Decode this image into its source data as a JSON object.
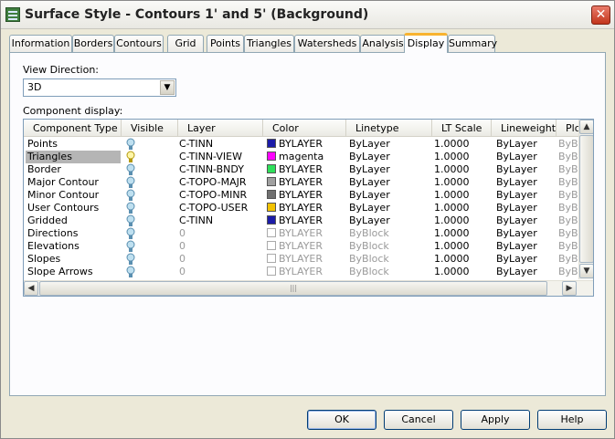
{
  "window": {
    "title": "Surface Style - Contours 1' and 5' (Background)",
    "close_label": "✕"
  },
  "tabs": [
    {
      "label": "Information",
      "active": false
    },
    {
      "label": "Borders",
      "active": false
    },
    {
      "label": "Contours",
      "active": false
    },
    {
      "label": "Grid",
      "active": false
    },
    {
      "label": "Points",
      "active": false
    },
    {
      "label": "Triangles",
      "active": false
    },
    {
      "label": "Watersheds",
      "active": false
    },
    {
      "label": "Analysis",
      "active": false
    },
    {
      "label": "Display",
      "active": true
    },
    {
      "label": "Summary",
      "active": false
    }
  ],
  "view_direction": {
    "label": "View Direction:",
    "value": "3D"
  },
  "component_display": {
    "label": "Component display:",
    "columns": [
      "Component Type",
      "Visible",
      "Layer",
      "Color",
      "Linetype",
      "LT Scale",
      "Lineweight",
      "Plo"
    ],
    "rows": [
      {
        "type": "Points",
        "visible": true,
        "lit": false,
        "layer": "C-TINN",
        "color": "BYLAYER",
        "swatch": "#1c1ca8",
        "linetype": "ByLayer",
        "lt_scale": "1.0000",
        "lineweight": "ByLayer",
        "plot": "ByBl",
        "dim": false,
        "selected": false
      },
      {
        "type": "Triangles",
        "visible": true,
        "lit": true,
        "layer": "C-TINN-VIEW",
        "color": "magenta",
        "swatch": "#ff00ff",
        "linetype": "ByLayer",
        "lt_scale": "1.0000",
        "lineweight": "ByLayer",
        "plot": "ByBl",
        "dim": false,
        "selected": true
      },
      {
        "type": "Border",
        "visible": true,
        "lit": false,
        "layer": "C-TINN-BNDY",
        "color": "BYLAYER",
        "swatch": "#2ee05a",
        "linetype": "ByLayer",
        "lt_scale": "1.0000",
        "lineweight": "ByLayer",
        "plot": "ByBl",
        "dim": false,
        "selected": false
      },
      {
        "type": "Major Contour",
        "visible": true,
        "lit": false,
        "layer": "C-TOPO-MAJR",
        "color": "BYLAYER",
        "swatch": "#a0a0a0",
        "linetype": "ByLayer",
        "lt_scale": "1.0000",
        "lineweight": "ByLayer",
        "plot": "ByBl",
        "dim": false,
        "selected": false
      },
      {
        "type": "Minor Contour",
        "visible": true,
        "lit": false,
        "layer": "C-TOPO-MINR",
        "color": "BYLAYER",
        "swatch": "#707070",
        "linetype": "ByLayer",
        "lt_scale": "1.0000",
        "lineweight": "ByLayer",
        "plot": "ByBl",
        "dim": false,
        "selected": false
      },
      {
        "type": "User Contours",
        "visible": true,
        "lit": false,
        "layer": "C-TOPO-USER",
        "color": "BYLAYER",
        "swatch": "#f2c200",
        "linetype": "ByLayer",
        "lt_scale": "1.0000",
        "lineweight": "ByLayer",
        "plot": "ByBl",
        "dim": false,
        "selected": false
      },
      {
        "type": "Gridded",
        "visible": true,
        "lit": false,
        "layer": "C-TINN",
        "color": "BYLAYER",
        "swatch": "#1c1ca8",
        "linetype": "ByLayer",
        "lt_scale": "1.0000",
        "lineweight": "ByLayer",
        "plot": "ByBl",
        "dim": false,
        "selected": false
      },
      {
        "type": "Directions",
        "visible": true,
        "lit": false,
        "layer": "0",
        "color": "BYLAYER",
        "swatch": "",
        "linetype": "ByBlock",
        "lt_scale": "1.0000",
        "lineweight": "ByLayer",
        "plot": "ByBl",
        "dim": true,
        "selected": false
      },
      {
        "type": "Elevations",
        "visible": true,
        "lit": false,
        "layer": "0",
        "color": "BYLAYER",
        "swatch": "",
        "linetype": "ByBlock",
        "lt_scale": "1.0000",
        "lineweight": "ByLayer",
        "plot": "ByBl",
        "dim": true,
        "selected": false
      },
      {
        "type": "Slopes",
        "visible": true,
        "lit": false,
        "layer": "0",
        "color": "BYLAYER",
        "swatch": "",
        "linetype": "ByBlock",
        "lt_scale": "1.0000",
        "lineweight": "ByLayer",
        "plot": "ByBl",
        "dim": true,
        "selected": false
      },
      {
        "type": "Slope Arrows",
        "visible": true,
        "lit": false,
        "layer": "0",
        "color": "BYLAYER",
        "swatch": "",
        "linetype": "ByBlock",
        "lt_scale": "1.0000",
        "lineweight": "ByLayer",
        "plot": "ByBl",
        "dim": true,
        "selected": false
      }
    ]
  },
  "buttons": {
    "ok": "OK",
    "cancel": "Cancel",
    "apply": "Apply",
    "help": "Help"
  }
}
